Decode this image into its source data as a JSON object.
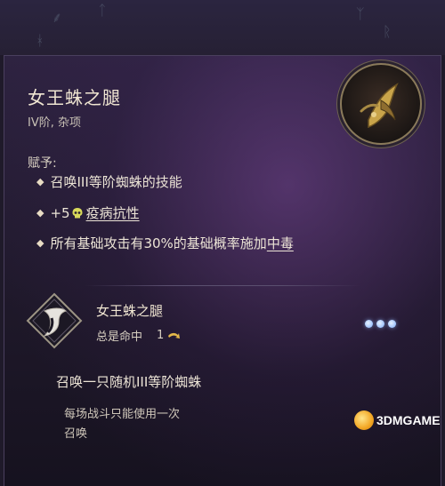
{
  "item": {
    "title": "女王蛛之腿",
    "subtitle": "IV阶, 杂项",
    "grant_label": "赋予:",
    "grants": [
      {
        "bullet": "◆",
        "text": "召唤III等阶蜘蛛的技能"
      },
      {
        "bullet": "◆",
        "prefix": "+5",
        "link": "疫病抗性",
        "icon": "skull-icon"
      },
      {
        "bullet": "◆",
        "text": "所有基础攻击有30%的基础概率施加",
        "link": "中毒"
      }
    ]
  },
  "ability": {
    "name": "女王蛛之腿",
    "accuracy": "总是命中",
    "count": "1",
    "more_dots": [
      "•",
      "•",
      "•"
    ],
    "description": "召唤一只随机III等阶蜘蛛",
    "notes": [
      "每场战斗只能使用一次",
      "召唤"
    ]
  },
  "watermark": {
    "logo_text": "3DM",
    "text": "3DMGAME"
  },
  "colors": {
    "background": "#1f1a2a",
    "panel_purple": "#2e2341",
    "text_cream": "#ece4d6",
    "dots_blue": "#9fc4ff",
    "icon_gold": "#c9a44a"
  }
}
